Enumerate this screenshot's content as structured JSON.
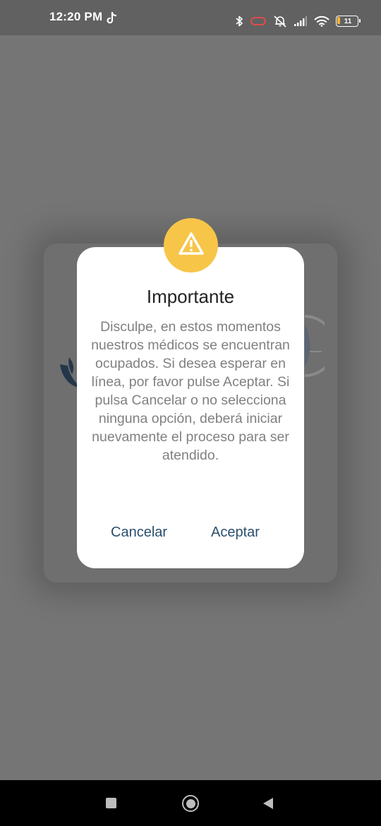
{
  "status_bar": {
    "time": "12:20 PM",
    "app_icon": "tiktok-icon",
    "icons": [
      "bluetooth-icon",
      "alarm-icon",
      "silent-bell-icon",
      "signal-icon",
      "wifi-icon",
      "battery-icon"
    ],
    "battery_level": "11",
    "battery_low_color": "#f2b632"
  },
  "dialog": {
    "icon": "warning-icon",
    "icon_color": "#f7c548",
    "title": "Importante",
    "message": "Disculpe, en estos momentos nuestros médicos se encuentran ocupados. Si desea esperar en línea, por favor pulse Aceptar. Si pulsa Cancelar o no selecciona ninguna opción, deberá iniciar nuevamente el proceso para ser atendido.",
    "cancel_label": "Cancelar",
    "accept_label": "Aceptar",
    "button_color": "#2b4f6e"
  },
  "nav_bar": {
    "icons": [
      "recents-icon",
      "home-icon",
      "back-icon"
    ]
  }
}
